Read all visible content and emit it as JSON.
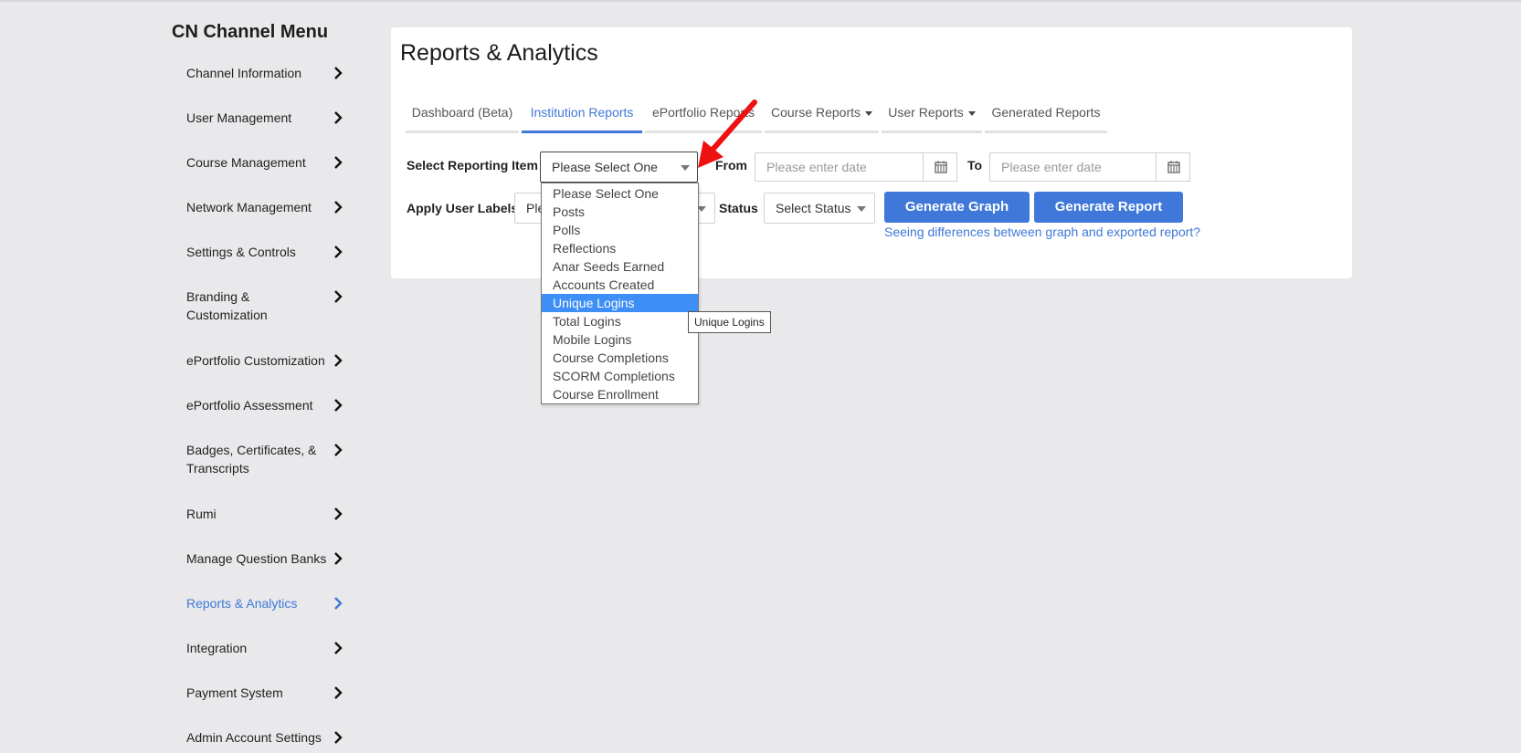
{
  "sidebar": {
    "title": "CN Channel Menu",
    "items": [
      {
        "label": "Channel Information"
      },
      {
        "label": "User Management"
      },
      {
        "label": "Course Management"
      },
      {
        "label": "Network Management"
      },
      {
        "label": "Settings & Controls"
      },
      {
        "label": "Branding & Customization"
      },
      {
        "label": "ePortfolio Customization"
      },
      {
        "label": "ePortfolio Assessment"
      },
      {
        "label": "Badges, Certificates, & Transcripts"
      },
      {
        "label": "Rumi"
      },
      {
        "label": "Manage Question Banks"
      },
      {
        "label": "Reports & Analytics",
        "active": true
      },
      {
        "label": "Integration"
      },
      {
        "label": "Payment System"
      },
      {
        "label": "Admin Account Settings"
      }
    ]
  },
  "main": {
    "title": "Reports & Analytics",
    "tabs": [
      {
        "label": "Dashboard (Beta)"
      },
      {
        "label": "Institution Reports",
        "active": true
      },
      {
        "label": "ePortfolio Reports"
      },
      {
        "label": "Course Reports",
        "dropdown": true
      },
      {
        "label": "User Reports",
        "dropdown": true
      },
      {
        "label": "Generated Reports"
      }
    ],
    "form": {
      "reporting_item_label": "Select Reporting Item",
      "reporting_item_value": "Please Select One",
      "from_label": "From",
      "from_placeholder": "Please enter date",
      "to_label": "To",
      "to_placeholder": "Please enter date",
      "user_labels_label": "Apply User Labels",
      "user_labels_value": "Ple",
      "status_label": "Status",
      "status_value": "Select Status",
      "generate_graph": "Generate Graph",
      "generate_report": "Generate Report",
      "differences_link": "Seeing differences between graph and exported report?"
    },
    "dropdown_options": [
      "Please Select One",
      "Posts",
      "Polls",
      "Reflections",
      "Anar Seeds Earned",
      "Accounts Created",
      "Unique Logins",
      "Total Logins",
      "Mobile Logins",
      "Course Completions",
      "SCORM Completions",
      "Course Enrollment"
    ],
    "highlighted_option": "Unique Logins",
    "tooltip": "Unique Logins"
  },
  "colors": {
    "accent": "#3f78d8",
    "highlight": "#3d8ef5",
    "annotation_arrow": "#ee1111",
    "background": "#e9e9ec"
  }
}
